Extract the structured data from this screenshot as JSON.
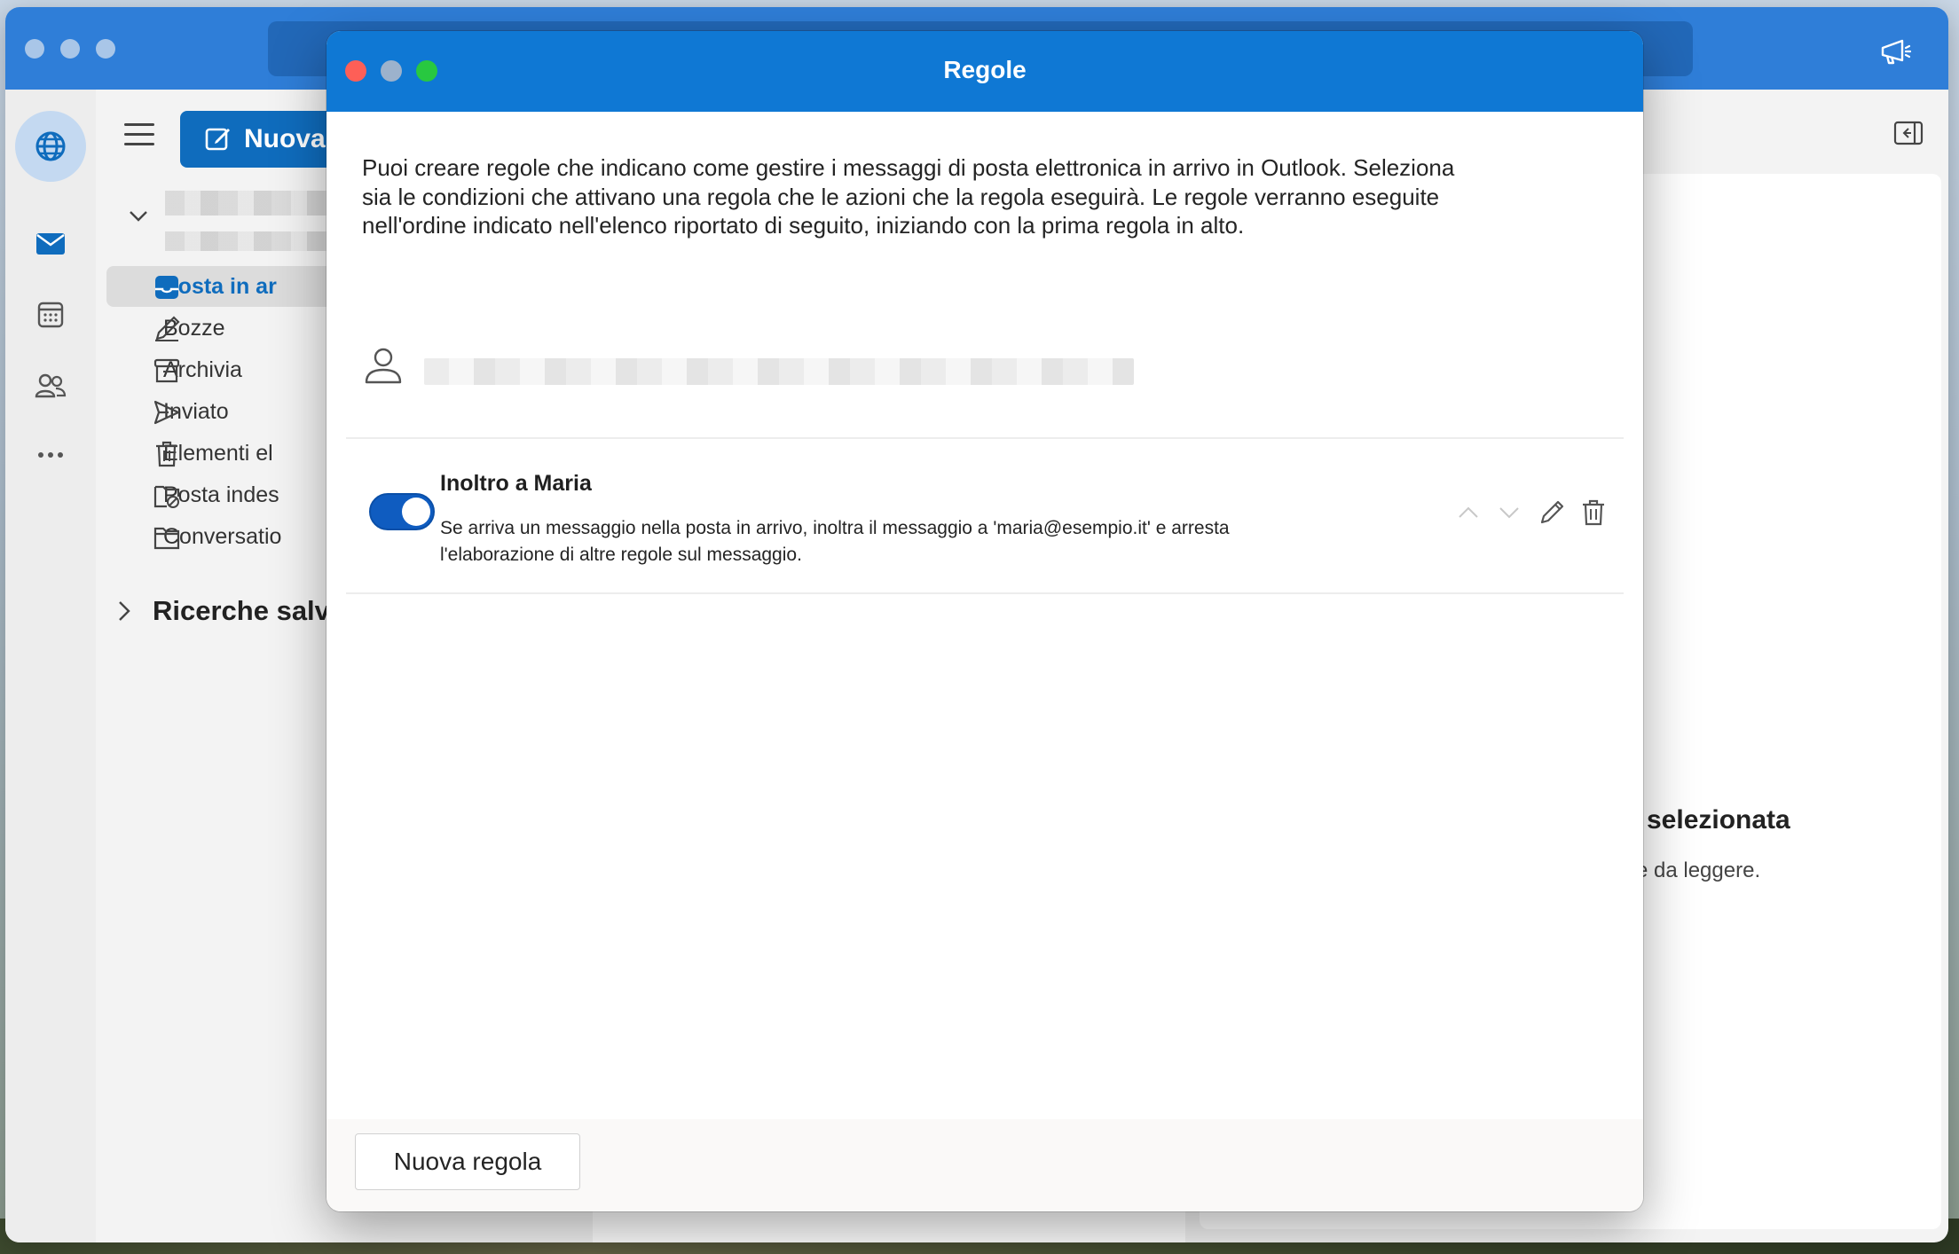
{
  "main": {
    "new_button_label": "Nuova",
    "folders": [
      {
        "label": "Posta in ar",
        "selected": true
      },
      {
        "label": "Bozze"
      },
      {
        "label": "Archivia"
      },
      {
        "label": "Inviato"
      },
      {
        "label": "Elementi el"
      },
      {
        "label": "Posta indes"
      },
      {
        "label": "Conversatio"
      }
    ],
    "saved_searches_label": "Ricerche salv",
    "empty_title": "selezionata",
    "empty_subtitle": "e da leggere."
  },
  "dialog": {
    "title": "Regole",
    "intro": "Puoi creare regole che indicano come gestire i messaggi di posta elettronica in arrivo in Outlook. Seleziona sia le condizioni che attivano una regola che le azioni che la regola eseguirà. Le regole verranno eseguite nell'ordine indicato nell'elenco riportato di seguito, iniziando con la prima regola in alto.",
    "rules": [
      {
        "name": "Inoltro a Maria",
        "enabled": true,
        "description": "Se arriva un messaggio nella posta in arrivo, inoltra il messaggio a 'maria@esempio.it' e arresta l'elaborazione di altre regole sul messaggio."
      }
    ],
    "new_rule_label": "Nuova regola"
  },
  "colors": {
    "accent": "#0f78d4",
    "toggle_on": "#0f5cc0"
  }
}
